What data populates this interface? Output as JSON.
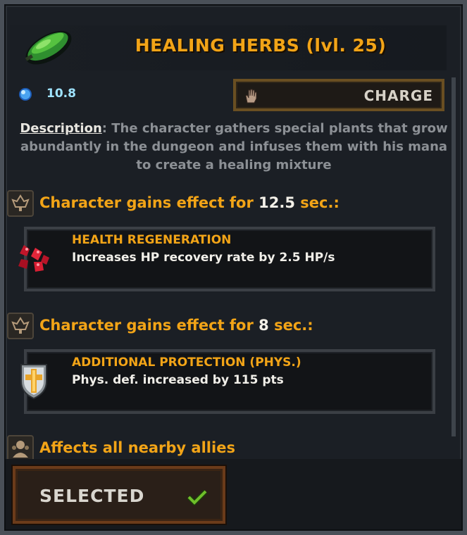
{
  "skill": {
    "name": "HEALING HERBS (lvl. 25)",
    "icon": "green-leaf-icon",
    "mana_cost": "10.8",
    "mana_icon": "mana-orb-icon",
    "charge_label": "CHARGE",
    "charge_icon": "hand-icon"
  },
  "description": {
    "label": "Description",
    "text": ": The character gathers special plants that grow abundantly in the dungeon and infuses them with his mana to create a healing mixture"
  },
  "effects": [
    {
      "heading_prefix": "Character gains effect for ",
      "duration": "12.5",
      "heading_suffix": " sec.:",
      "heading_icon": "effect-rune-icon",
      "title": "HEALTH REGENERATION",
      "desc": "Increases HP recovery rate by 2.5 HP/s",
      "icon": "red-crystals-icon"
    },
    {
      "heading_prefix": "Character gains effect for ",
      "duration": "8",
      "heading_suffix": " sec.:",
      "heading_icon": "effect-rune-icon",
      "title": "ADDITIONAL PROTECTION (PHYS.)",
      "desc": "Phys. def. increased by 115 pts",
      "icon": "shield-cross-icon"
    }
  ],
  "area": {
    "text": "Affects all nearby allies",
    "icon": "allies-icon"
  },
  "footer": {
    "selected_label": "SELECTED",
    "check_icon": "check-icon"
  },
  "colors": {
    "accent": "#f2a417",
    "mana": "#9fe3ff",
    "panel": "#1b1f25",
    "check": "#6fbe2a"
  }
}
